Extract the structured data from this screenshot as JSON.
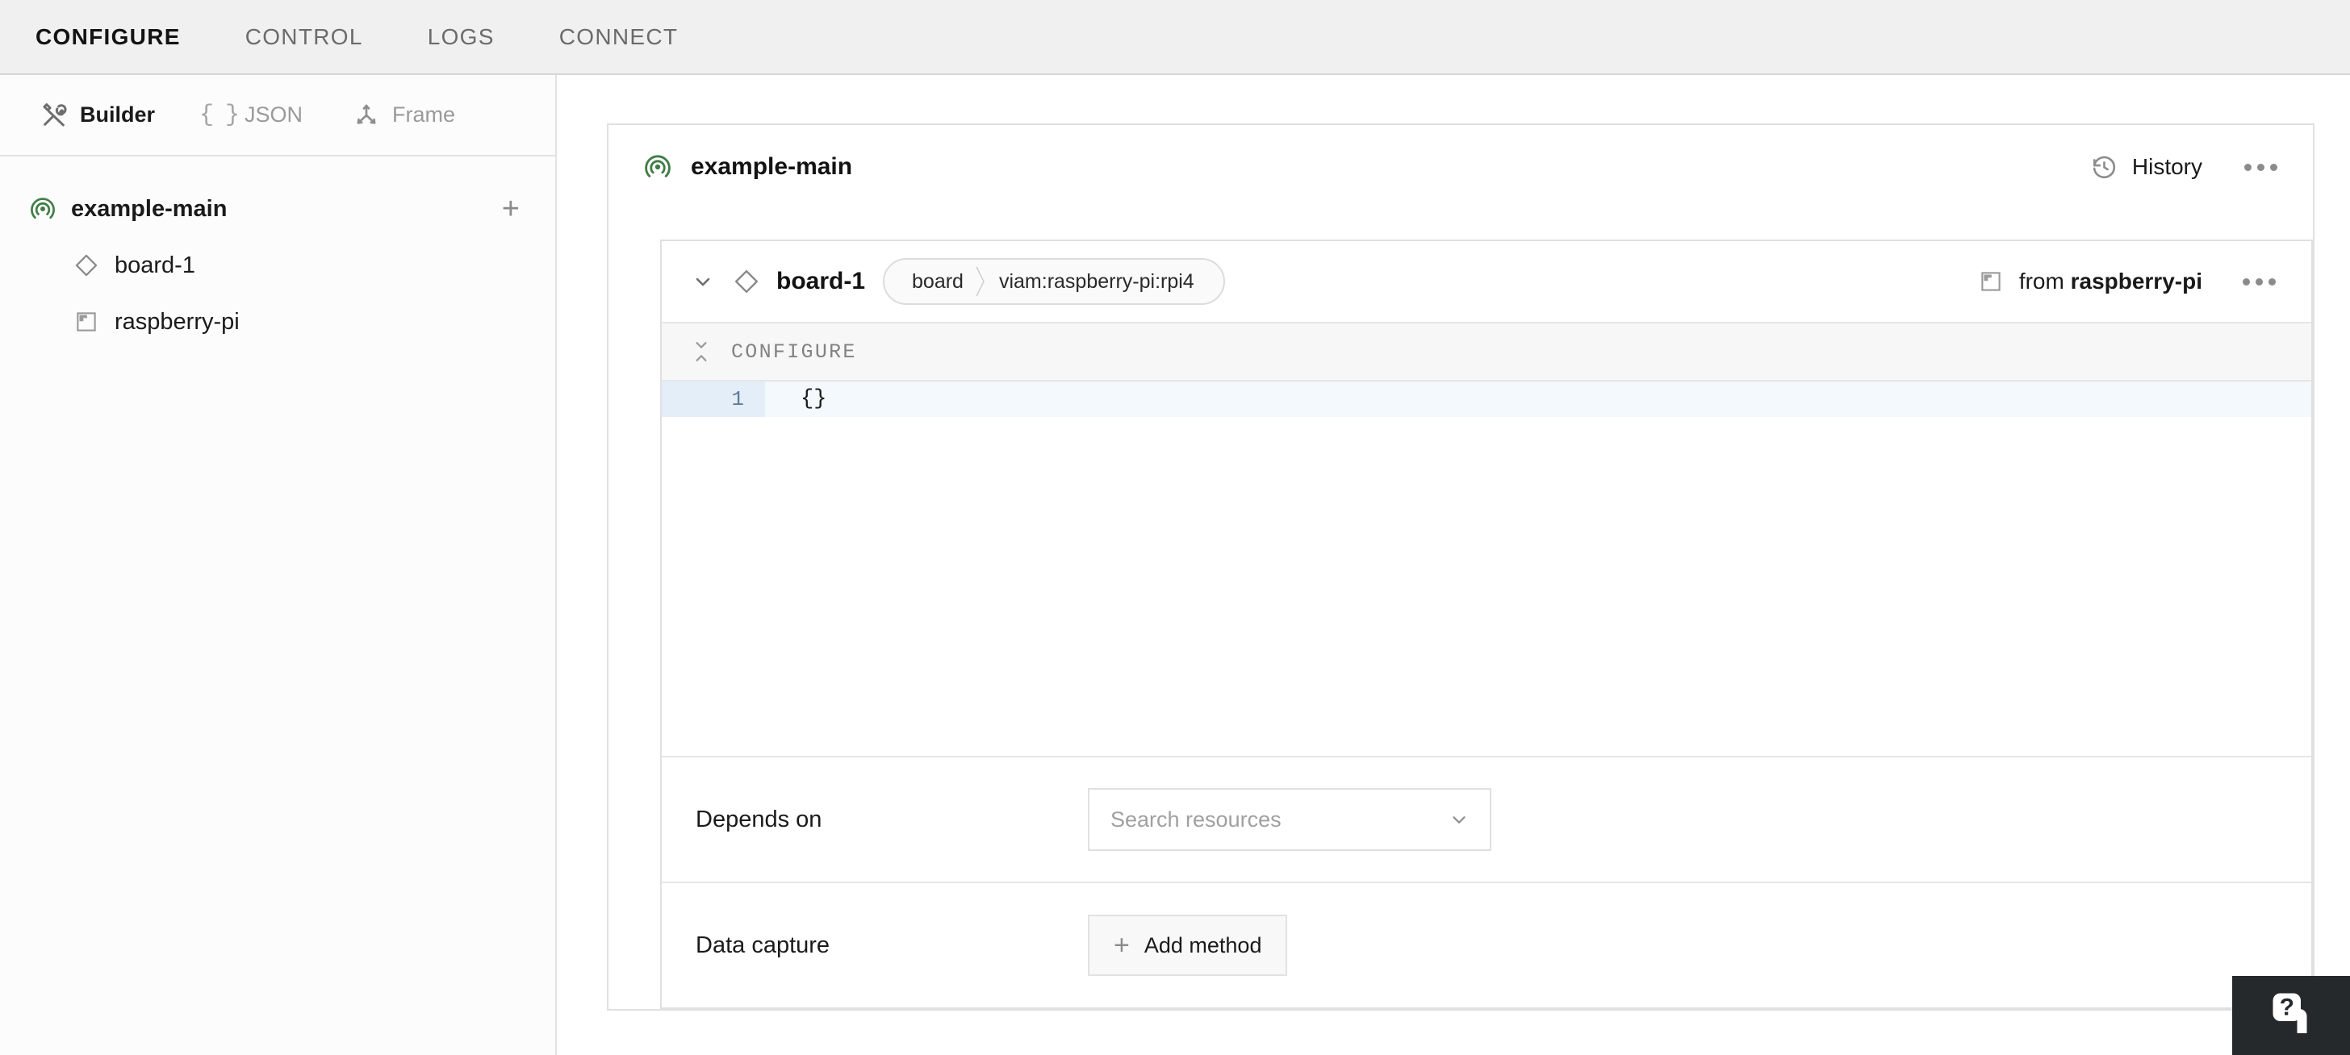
{
  "topnav": {
    "tabs": [
      {
        "label": "CONFIGURE",
        "active": true
      },
      {
        "label": "CONTROL",
        "active": false
      },
      {
        "label": "LOGS",
        "active": false
      },
      {
        "label": "CONNECT",
        "active": false
      }
    ]
  },
  "sidebar": {
    "toolbar": [
      {
        "label": "Builder",
        "icon": "tools-icon",
        "active": true
      },
      {
        "label": "JSON",
        "icon": "braces-icon",
        "active": false
      },
      {
        "label": "Frame",
        "icon": "frame-axes-icon",
        "active": false
      }
    ],
    "tree": {
      "root": {
        "label": "example-main",
        "icon": "machine-signal-icon"
      },
      "add_label": "+",
      "children": [
        {
          "label": "board-1",
          "icon": "diamond-icon"
        },
        {
          "label": "raspberry-pi",
          "icon": "module-icon"
        }
      ]
    }
  },
  "main": {
    "panel": {
      "title": "example-main",
      "icon": "machine-signal-icon",
      "history_label": "History",
      "history_icon": "clock-rewind-icon",
      "more_menu": "…"
    },
    "resource_card": {
      "name": "board-1",
      "icon": "diamond-icon",
      "chevron": "chevron-down-icon",
      "pill": {
        "type": "board",
        "model": "viam:raspberry-pi:rpi4"
      },
      "from": {
        "prefix": "from",
        "module": "raspberry-pi",
        "icon": "module-icon"
      },
      "more_menu": "…",
      "configure": {
        "section_label": "CONFIGURE",
        "collapse_icon": "collapse-icon",
        "lines": [
          {
            "number": "1",
            "text": "{}"
          }
        ]
      },
      "depends_on": {
        "label": "Depends on",
        "placeholder": "Search resources",
        "chevron": "chevron-down-icon"
      },
      "data_capture": {
        "label": "Data capture",
        "add_label": "Add method",
        "add_icon": "plus-icon"
      }
    }
  },
  "help_widget": {
    "icon": "help-question-card-icon",
    "aria": "Help"
  },
  "colors": {
    "accent_green": "#3f7d45",
    "nav_bg": "#f0f0f0",
    "text_primary": "#131313",
    "text_muted": "#8e8e8e",
    "border": "#e0e0e0",
    "editor_gutter": "#e4eef8",
    "editor_active_line": "#f3f9fd",
    "help_bg": "#26292b"
  }
}
